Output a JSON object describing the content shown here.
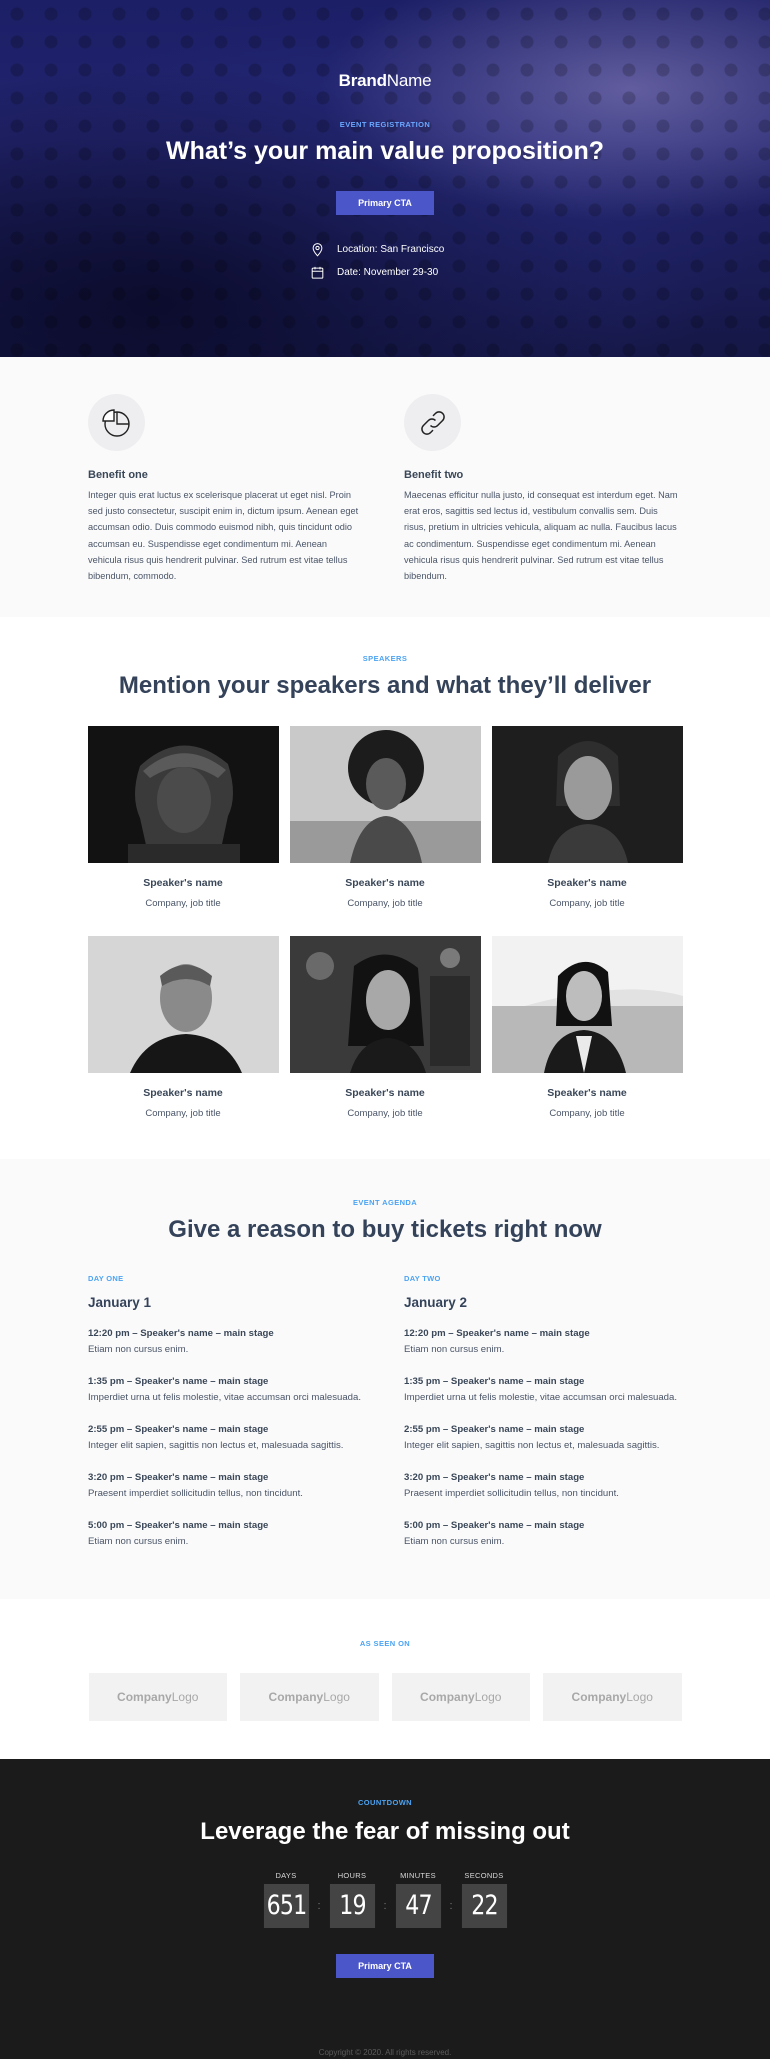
{
  "hero": {
    "brand_bold": "Brand",
    "brand_light": "Name",
    "eyebrow": "EVENT REGISTRATION",
    "title": "What’s your main value proposition?",
    "cta_label": "Primary CTA",
    "location": "Location: San Francisco",
    "date": "Date: November 29-30"
  },
  "benefits": [
    {
      "icon": "pie-chart-icon",
      "title": "Benefit one",
      "text": "Integer quis erat luctus ex scelerisque placerat ut eget nisl. Proin sed justo consectetur, suscipit enim in, dictum ipsum. Aenean eget accumsan odio. Duis commodo euismod nibh, quis tincidunt odio accumsan eu. Suspendisse eget condimentum mi. Aenean vehicula risus quis hendrerit pulvinar. Sed rutrum est vitae tellus bibendum, commodo."
    },
    {
      "icon": "link-icon",
      "title": "Benefit two",
      "text": "Maecenas efficitur nulla justo, id consequat est interdum eget. Nam erat eros, sagittis sed lectus id, vestibulum convallis sem. Duis risus, pretium in ultricies vehicula, aliquam ac nulla. Faucibus lacus ac condimentum. Suspendisse eget condimentum mi. Aenean vehicula risus quis hendrerit pulvinar. Sed rutrum est vitae tellus bibendum."
    }
  ],
  "speakers": {
    "eyebrow": "SPEAKERS",
    "title": "Mention your speakers and what they’ll deliver",
    "items": [
      {
        "name": "Speaker's name",
        "role": "Company, job title"
      },
      {
        "name": "Speaker's name",
        "role": "Company, job title"
      },
      {
        "name": "Speaker's name",
        "role": "Company, job title"
      },
      {
        "name": "Speaker's name",
        "role": "Company, job title"
      },
      {
        "name": "Speaker's name",
        "role": "Company, job title"
      },
      {
        "name": "Speaker's name",
        "role": "Company, job title"
      }
    ]
  },
  "agenda": {
    "eyebrow": "EVENT AGENDA",
    "title": "Give a reason to buy tickets right now",
    "days": [
      {
        "label": "DAY ONE",
        "date": "January 1",
        "items": [
          {
            "time": "12:20 pm – Speaker's name – main stage",
            "desc": "Etiam non cursus enim."
          },
          {
            "time": "1:35 pm – Speaker's name – main stage",
            "desc": "Imperdiet urna ut felis molestie, vitae accumsan orci malesuada."
          },
          {
            "time": "2:55 pm – Speaker's name – main stage",
            "desc": "Integer elit sapien, sagittis non lectus et, malesuada sagittis."
          },
          {
            "time": "3:20 pm – Speaker's name – main stage",
            "desc": "Praesent imperdiet sollicitudin tellus, non tincidunt."
          },
          {
            "time": "5:00 pm – Speaker's name – main stage",
            "desc": "Etiam non cursus enim."
          }
        ]
      },
      {
        "label": "DAY TWO",
        "date": "January 2",
        "items": [
          {
            "time": "12:20 pm – Speaker's name – main stage",
            "desc": "Etiam non cursus enim."
          },
          {
            "time": "1:35 pm – Speaker's name – main stage",
            "desc": "Imperdiet urna ut felis molestie, vitae accumsan orci malesuada."
          },
          {
            "time": "2:55 pm – Speaker's name – main stage",
            "desc": "Integer elit sapien, sagittis non lectus et, malesuada sagittis."
          },
          {
            "time": "3:20 pm – Speaker's name – main stage",
            "desc": "Praesent imperdiet sollicitudin tellus, non tincidunt."
          },
          {
            "time": "5:00 pm – Speaker's name – main stage",
            "desc": "Etiam non cursus enim."
          }
        ]
      }
    ]
  },
  "seen_on": {
    "eyebrow": "AS SEEN ON",
    "logos": [
      {
        "bold": "Company",
        "light": "Logo"
      },
      {
        "bold": "Company",
        "light": "Logo"
      },
      {
        "bold": "Company",
        "light": "Logo"
      },
      {
        "bold": "Company",
        "light": "Logo"
      }
    ]
  },
  "countdown": {
    "eyebrow": "COUNTDOWN",
    "title": "Leverage the fear of missing out",
    "units": [
      {
        "label": "DAYS",
        "value": "651"
      },
      {
        "label": "HOURS",
        "value": "19"
      },
      {
        "label": "MINUTES",
        "value": "47"
      },
      {
        "label": "SECONDS",
        "value": "22"
      }
    ],
    "cta_label": "Primary CTA",
    "copyright": "Copyright © 2020. All rights reserved."
  },
  "colors": {
    "accent": "#4b56c8",
    "eyebrow": "#4ba3f3",
    "heading": "#34435a",
    "countdown_bg": "#1b1b1b"
  }
}
